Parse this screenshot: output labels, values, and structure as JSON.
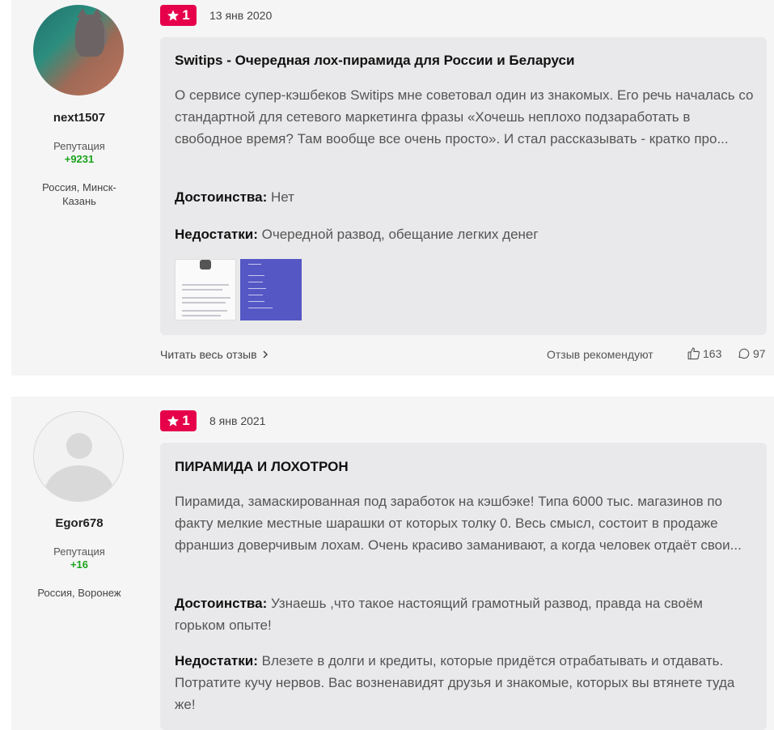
{
  "reviews": [
    {
      "user": {
        "name": "next1507",
        "reputation_label": "Репутация",
        "reputation": "+9231",
        "location": "Россия, Минск-Казань"
      },
      "rating": "1",
      "date": "13 янв 2020",
      "title": "Switips - Очередная лох-пирамида для России и Беларуси",
      "text": "О сервисе супер-кэшбеков Switips мне советовал один из знакомых. Его речь началась со стандартной для сетевого маркетинга фразы «Хочешь неплохо подзаработать в свободное время? Там вообще все очень просто». И стал рассказывать - кратко про...",
      "pros_label": "Достоинства:",
      "pros": "Нет",
      "cons_label": "Недостатки:",
      "cons": "Очередной развод, обещание легких денег",
      "read_more": "Читать весь отзыв",
      "recommend_label": "Отзыв рекомендуют",
      "likes": "163",
      "comments": "97"
    },
    {
      "user": {
        "name": "Egor678",
        "reputation_label": "Репутация",
        "reputation": "+16",
        "location": "Россия, Воронеж"
      },
      "rating": "1",
      "date": "8 янв 2021",
      "title": "ПИРАМИДА И ЛОХОТРОН",
      "text": "Пирамида, замаскированная под заработок на кэшбэке! Типа 6000 тыс. магазинов по факту мелкие местные шарашки от которых толку 0. Весь смысл, состоит в продаже франшиз доверчивым лохам. Очень красиво заманивают, а когда человек отдаёт свои...",
      "pros_label": "Достоинства:",
      "pros": "Узнаешь ,что такое настоящий грамотный развод, правда на своём горьком опыте!",
      "cons_label": "Недостатки:",
      "cons": "Влезете в долги и кредиты, которые придётся отрабатывать и отдавать. Потратите кучу нервов. Вас возненавидят друзья и знакомые, которых вы втянете туда же!"
    }
  ]
}
